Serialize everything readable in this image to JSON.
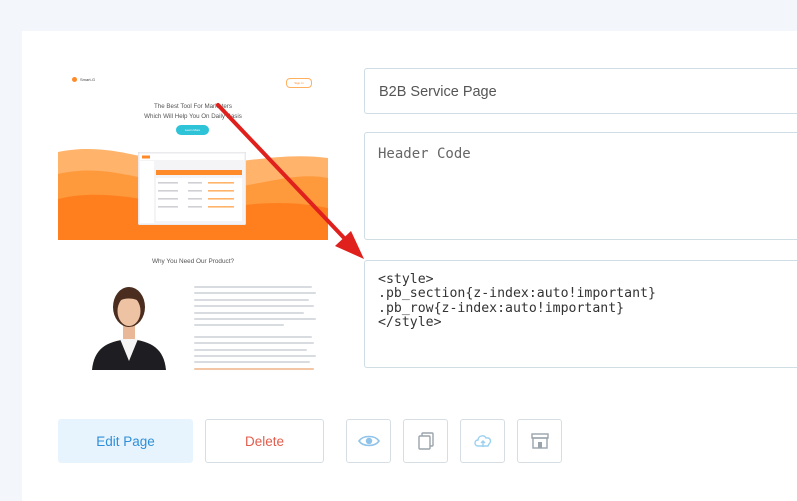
{
  "thumbnail": {
    "brand": "Smart-G",
    "nav_button": "Sign In",
    "headline_line1": "The Best Tool For Marketers",
    "headline_line2": "Which Will Help You On Daily Basis",
    "cta": "Learn More",
    "section_title": "Why You Need Our Product?"
  },
  "form": {
    "page_title_value": "B2B Service Page",
    "header_code_placeholder": "Header Code",
    "code_value": "<style>\n.pb_section{z-index:auto!important}\n.pb_row{z-index:auto!important}\n</style>"
  },
  "actions": {
    "edit_label": "Edit Page",
    "delete_label": "Delete",
    "view_icon": "eye-icon",
    "copy_icon": "copy-icon",
    "cloud_icon": "cloud-upload-icon",
    "store_icon": "store-icon"
  },
  "colors": {
    "accent": "#2f8fd8",
    "danger": "#e25d4d",
    "annotation_arrow": "#e0201c"
  }
}
